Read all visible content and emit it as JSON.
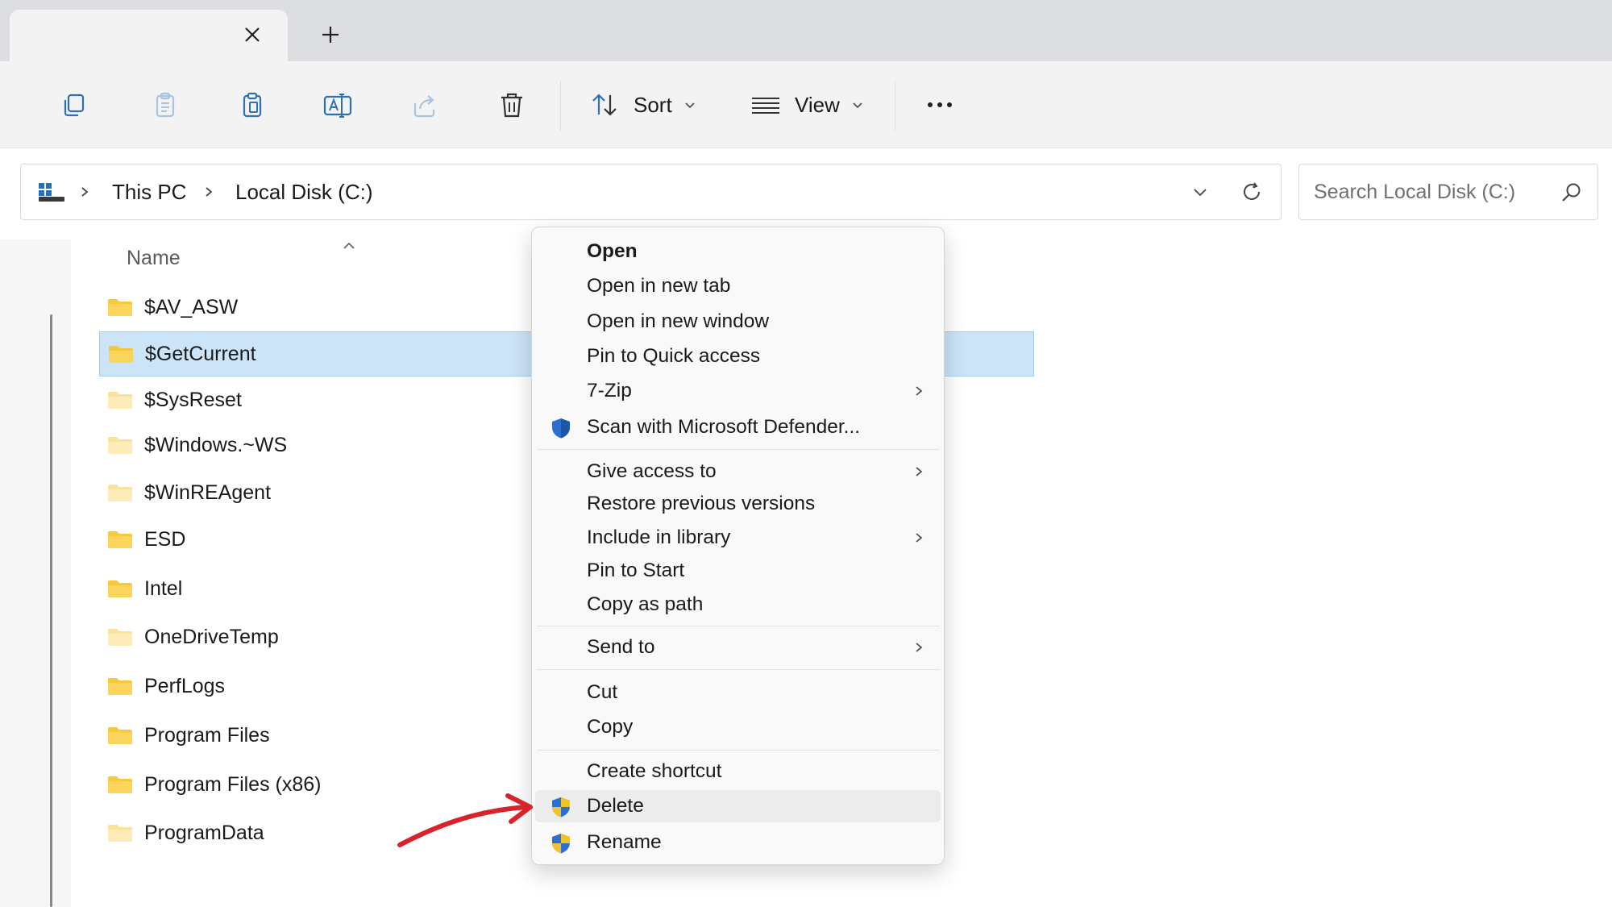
{
  "toolbar": {
    "sort_label": "Sort",
    "view_label": "View"
  },
  "address": {
    "crumbs": [
      "This PC",
      "Local Disk (C:)"
    ]
  },
  "search": {
    "placeholder": "Search Local Disk (C:)"
  },
  "file_list": {
    "column_name": "Name",
    "rows": [
      {
        "name": "$AV_ASW",
        "selected": false
      },
      {
        "name": "$GetCurrent",
        "selected": true
      },
      {
        "name": "$SysReset",
        "selected": false
      },
      {
        "name": "$Windows.~WS",
        "selected": false
      },
      {
        "name": "$WinREAgent",
        "selected": false
      },
      {
        "name": "ESD",
        "selected": false
      },
      {
        "name": "Intel",
        "selected": false
      },
      {
        "name": "OneDriveTemp",
        "selected": false
      },
      {
        "name": "PerfLogs",
        "selected": false
      },
      {
        "name": "Program Files",
        "selected": false
      },
      {
        "name": "Program Files (x86)",
        "selected": false
      },
      {
        "name": "ProgramData",
        "selected": false
      }
    ]
  },
  "context_menu": {
    "items": [
      {
        "label": "Open"
      },
      {
        "label": "Open in new tab"
      },
      {
        "label": "Open in new window"
      },
      {
        "label": "Pin to Quick access"
      },
      {
        "label": "7-Zip",
        "submenu": true
      },
      {
        "label": "Scan with Microsoft Defender...",
        "icon": "defender-shield-icon"
      },
      {
        "label": "Give access to",
        "submenu": true
      },
      {
        "label": "Restore previous versions"
      },
      {
        "label": "Include in library",
        "submenu": true
      },
      {
        "label": "Pin to Start"
      },
      {
        "label": "Copy as path"
      },
      {
        "label": "Send to",
        "submenu": true
      },
      {
        "label": "Cut"
      },
      {
        "label": "Copy"
      },
      {
        "label": "Create shortcut"
      },
      {
        "label": "Delete",
        "icon": "uac-shield-icon",
        "highlighted": true
      },
      {
        "label": "Rename",
        "icon": "uac-shield-icon"
      }
    ]
  },
  "colors": {
    "selection": "#cce4f7",
    "folder": "#f8c83c",
    "annotation_arrow": "#d8232a"
  }
}
